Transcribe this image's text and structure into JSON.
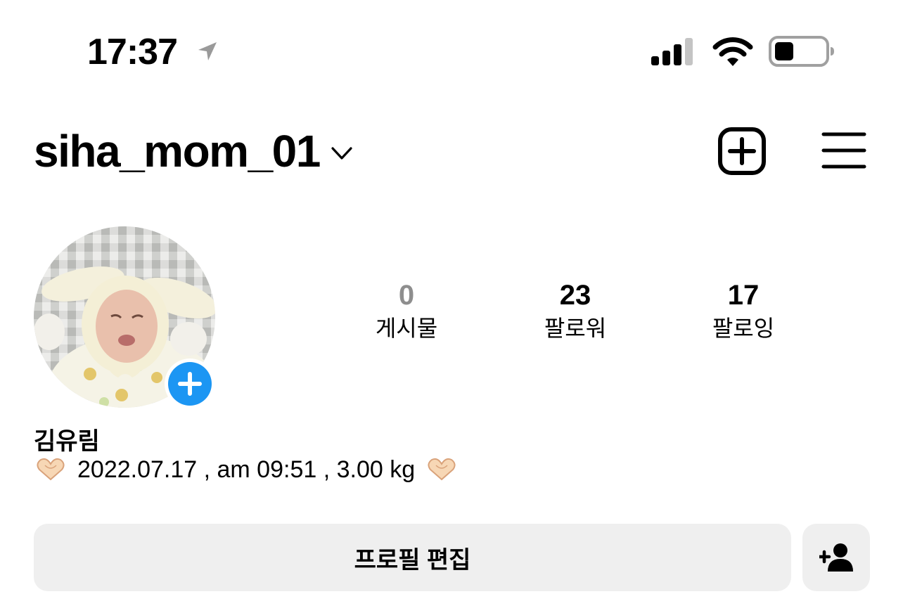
{
  "status_bar": {
    "time": "17:37",
    "icons": [
      "location-arrow-icon",
      "cellular-signal-icon",
      "wifi-icon",
      "battery-icon"
    ]
  },
  "header": {
    "username": "siha_mom_01",
    "icons": [
      "chevron-down-icon",
      "new-post-icon",
      "hamburger-menu-icon"
    ]
  },
  "profile": {
    "stats": [
      {
        "value": "0",
        "label": "게시물"
      },
      {
        "value": "23",
        "label": "팔로워"
      },
      {
        "value": "17",
        "label": "팔로잉"
      }
    ],
    "display_name": "김유림",
    "bio": "2022.07.17 , am 09:51 , 3.00 kg",
    "bio_emoji": "heart-hands-icon"
  },
  "actions": {
    "edit_profile_label": "프로필 편집",
    "discover_icon": "add-person-icon"
  },
  "colors": {
    "accent_blue": "#1c96f3",
    "button_bg": "#efefef",
    "muted_text": "#8e8e8e"
  }
}
